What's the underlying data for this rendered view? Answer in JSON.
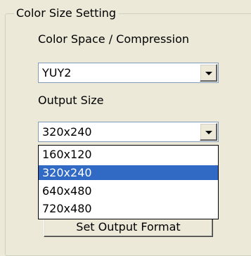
{
  "group": {
    "title": "Color Size Setting"
  },
  "color_space": {
    "label": "Color Space / Compression",
    "value": "YUY2"
  },
  "output_size": {
    "label": "Output Size",
    "value": "320x240",
    "options": [
      "160x120",
      "320x240",
      "640x480",
      "720x480"
    ],
    "highlighted": "320x240"
  },
  "button": {
    "label": "Set Output Format"
  },
  "colors": {
    "background": "#ece9d8",
    "selection": "#316ac5",
    "field_border": "#7f9db9"
  }
}
